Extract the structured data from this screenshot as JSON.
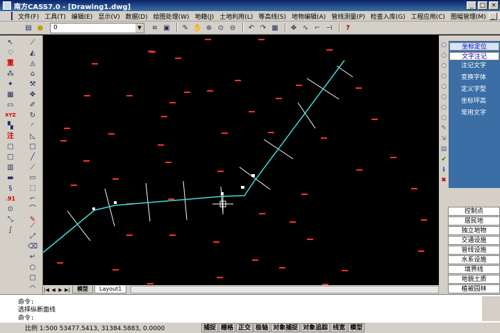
{
  "window": {
    "title": "南方CASS7.0 - [Drawing1.dwg]",
    "min": "_",
    "max": "□",
    "close": "×"
  },
  "menu": [
    "文件(F)",
    "工具(T)",
    "编辑(E)",
    "显示(V)",
    "数据(D)",
    "绘图处理(W)",
    "地籍(J)",
    "土地利用(L)",
    "等高线(S)",
    "地物编辑(A)",
    "管线测量(P)",
    "检查入库(G)",
    "工程应用(C)",
    "图幅管理(M)"
  ],
  "toolbar": {
    "layer_value": "0"
  },
  "tabs": {
    "model": "模型",
    "layout": "Layout1"
  },
  "right_panel": {
    "top": [
      "坐标定位",
      "文字注记"
    ],
    "text_items": [
      "注记文字",
      "变换字体",
      "定义字型",
      "坐标坪高",
      "常用文字"
    ],
    "list": [
      "控制点",
      "居民地",
      "独立地物",
      "交通设施",
      "管线设施",
      "水系设施",
      "境界线",
      "地貌土质",
      "植被园林"
    ]
  },
  "command": {
    "line1": "命令:",
    "line2": "选择纵断面线",
    "line3": "命令:"
  },
  "status": {
    "scale": "比例 1:500 53477.5413, 31384.5883, 0.0000",
    "toggles": [
      "捕捉",
      "栅格",
      "正交",
      "极轴",
      "对象捕捉",
      "对象追踪",
      "线宽",
      "模型"
    ]
  },
  "colors": {
    "polyline": "#40e0e0",
    "section": "#ffffff",
    "points": "#ff3030",
    "panel_blue": "#3a6ea5"
  },
  "icons": {
    "toolbar": [
      "layers-icon",
      "bulb-icon",
      "sun-icon",
      "lock-icon",
      "color-icon",
      "list-icon",
      "save-icon",
      "pencil-icon",
      "pan-icon",
      "zoom-realtime-icon",
      "zoom-window-icon",
      "zoom-previous-icon",
      "undo-icon",
      "redo-icon",
      "grid-icon",
      "pick-icon",
      "link-icon",
      "break-icon",
      "help-icon"
    ]
  },
  "left_icons": [
    "pointer-icon",
    "line-icon",
    "triangle-icon",
    "pencil-icon",
    "redo-text",
    "area-icon",
    "axes-icon",
    "roof-icon",
    "gear-icon",
    "grid-icon",
    "tool-icon",
    "move-icon",
    "table-icon",
    "pencil-icon",
    "xyz-icon",
    "rotate-icon",
    "mosaic-icon",
    "arc-icon",
    "note-text",
    "page-icon",
    "square-icon",
    "polyline-icon",
    "rect-icon",
    "slash-icon",
    "hatch-icon",
    "dash-icon",
    "ruler-icon",
    "dotrect-icon",
    "special-icon",
    "arc-icon",
    "coord-icon",
    "curve-icon",
    "circle-icon",
    "spline-icon",
    "ruler-icon",
    "eraser-icon",
    "stroke-icon"
  ]
}
